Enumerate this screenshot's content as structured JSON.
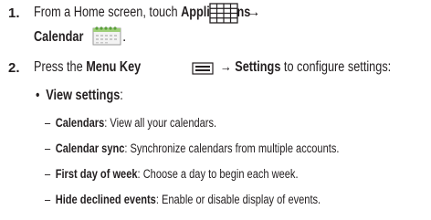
{
  "steps": [
    {
      "number": "1.",
      "part1": "From a Home screen, touch ",
      "applications": "Applications",
      "arrow": "→",
      "calendar": "Calendar",
      "period": "."
    },
    {
      "number": "2.",
      "press": "Press the ",
      "menu_key": "Menu Key",
      "arrow": "→",
      "settings": "Settings",
      "rest": " to configure settings:"
    }
  ],
  "view_settings": {
    "bullet": "•",
    "label": "View settings",
    "colon": ":"
  },
  "settings_items": [
    {
      "dash": "–",
      "name": "Calendars",
      "desc": ": View all your calendars."
    },
    {
      "dash": "–",
      "name": "Calendar sync",
      "desc": ": Synchronize calendars from multiple accounts."
    },
    {
      "dash": "–",
      "name": "First day of week",
      "desc": ": Choose a day to begin each week."
    },
    {
      "dash": "–",
      "name": "Hide declined events",
      "desc": ": Enable or disable display of events."
    }
  ]
}
